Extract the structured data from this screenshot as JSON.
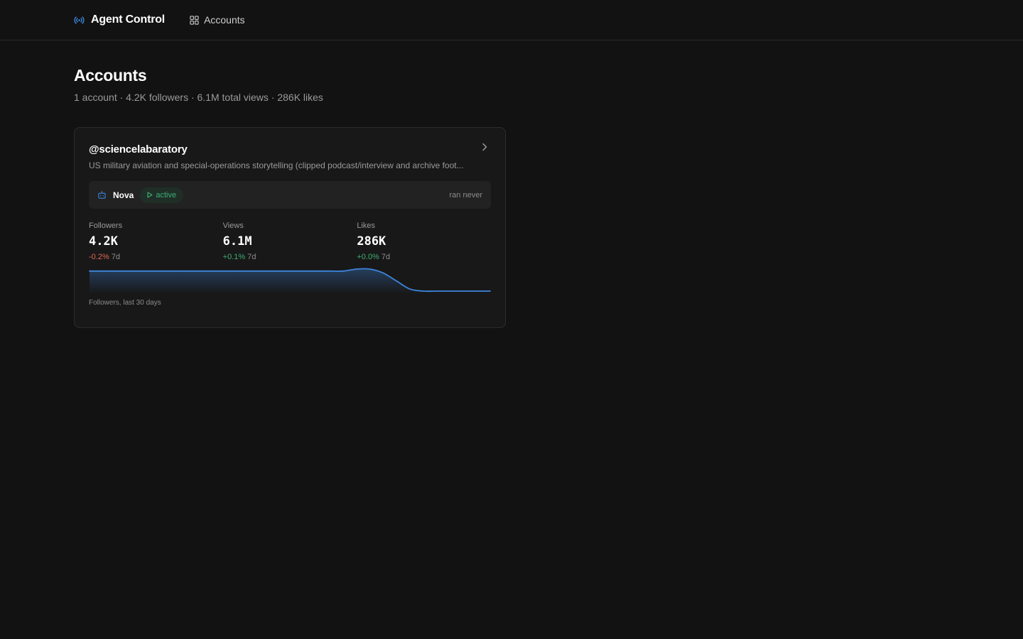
{
  "header": {
    "app_title": "Agent Control",
    "nav": [
      {
        "label": "Accounts",
        "icon": "grid-icon"
      }
    ]
  },
  "page": {
    "title": "Accounts",
    "summary": "1 account · 4.2K followers · 6.1M total views · 286K likes"
  },
  "accounts": [
    {
      "handle": "@sciencelabaratory",
      "bio": "US military aviation and special-operations storytelling (clipped podcast/interview and archive foot...",
      "agent": {
        "name": "Nova",
        "status": "active",
        "last_run": "ran never"
      },
      "metrics": [
        {
          "label": "Followers",
          "value": "4.2K",
          "change": "-0.2%",
          "period": "7d",
          "trend": "negative"
        },
        {
          "label": "Views",
          "value": "6.1M",
          "change": "+0.1%",
          "period": "7d",
          "trend": "positive"
        },
        {
          "label": "Likes",
          "value": "286K",
          "change": "+0.0%",
          "period": "7d",
          "trend": "positive"
        }
      ],
      "sparkline": {
        "caption": "Followers, last 30 days",
        "values": [
          4210,
          4210,
          4210,
          4210,
          4210,
          4210,
          4210,
          4210,
          4210,
          4210,
          4210,
          4210,
          4210,
          4210,
          4210,
          4210,
          4210,
          4210,
          4210,
          4210,
          4211,
          4211,
          4209,
          4205,
          4201,
          4200,
          4200,
          4200,
          4200,
          4200,
          4200
        ],
        "color": "#3d86dd"
      }
    }
  ],
  "colors": {
    "accent": "#3d86dd",
    "positive": "#3fae73",
    "negative": "#e0694e",
    "background": "#121212"
  }
}
